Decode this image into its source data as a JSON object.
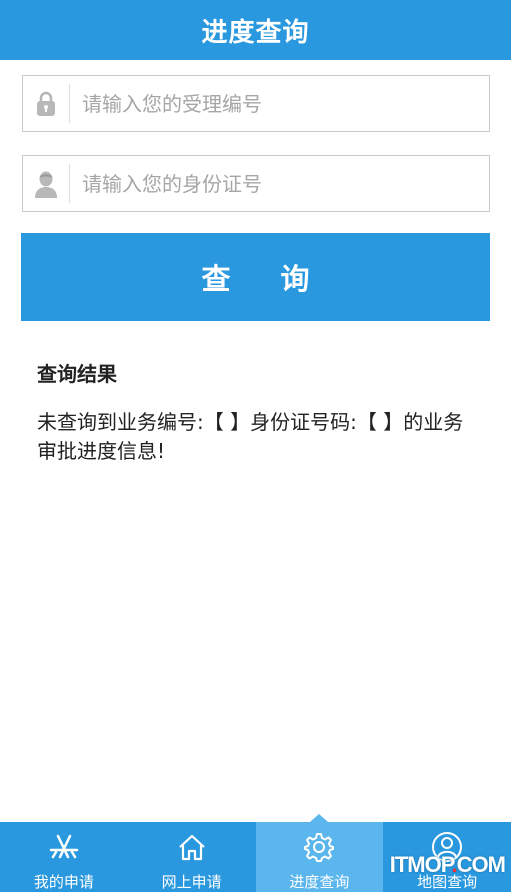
{
  "header": {
    "title": "进度查询"
  },
  "form": {
    "acceptance_placeholder": "请输入您的受理编号",
    "acceptance_value": "",
    "idcard_placeholder": "请输入您的身份证号",
    "idcard_value": "",
    "query_button_label": "查 询"
  },
  "result": {
    "title": "查询结果",
    "message": "未查询到业务编号:【 】身份证号码:【 】的业务审批进度信息!"
  },
  "tabbar": {
    "tabs": [
      {
        "label": "我的申请",
        "icon": "app-store-icon"
      },
      {
        "label": "网上申请",
        "icon": "home-icon"
      },
      {
        "label": "进度查询",
        "icon": "gear-icon",
        "active": true
      },
      {
        "label": "地图查询",
        "icon": "user-circle-icon"
      }
    ]
  },
  "watermark": {
    "text_main": "ITMOP",
    "text_dot": ".",
    "text_tail": "COM"
  },
  "colors": {
    "primary": "#2a98de",
    "active_tab": "#5ab6ec"
  }
}
